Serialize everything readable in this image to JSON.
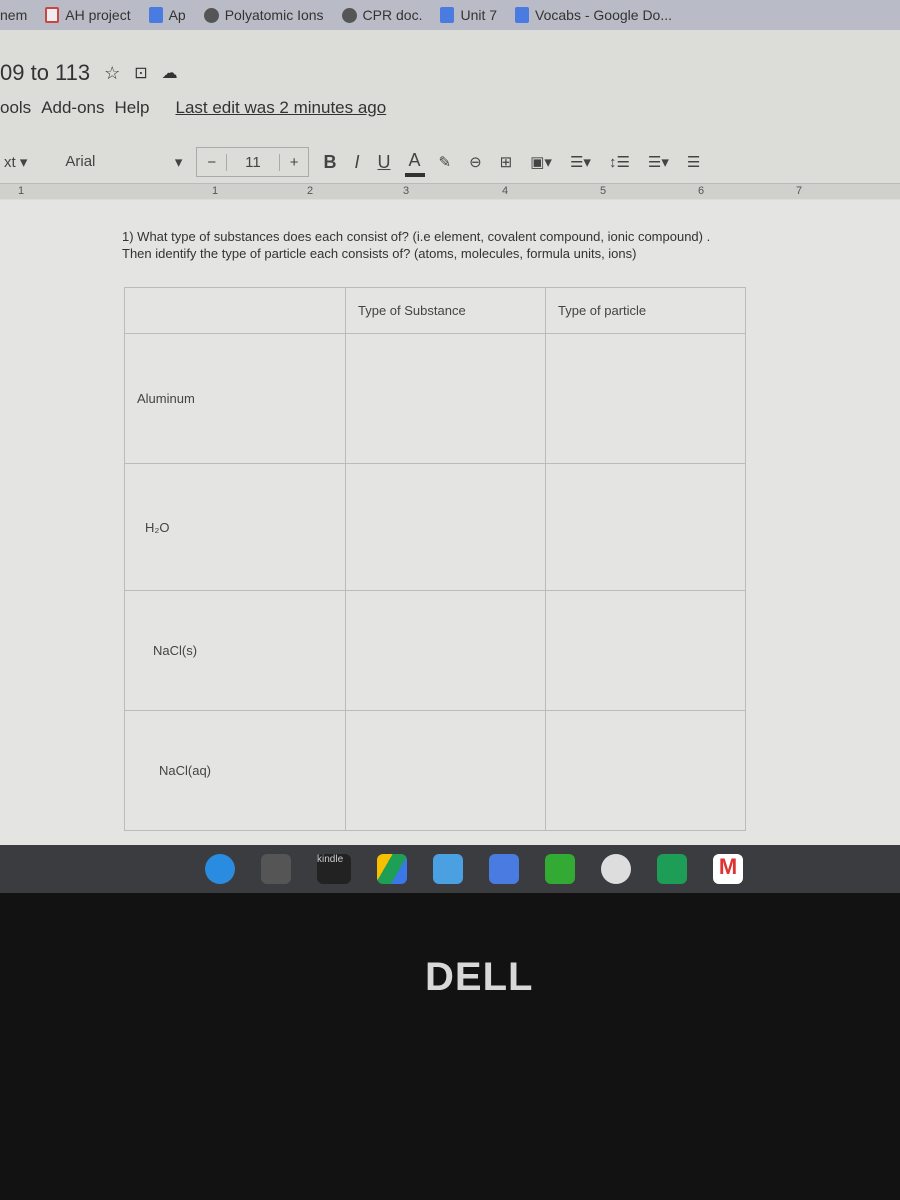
{
  "bookmarks": [
    "nem",
    "AH project",
    "Ap",
    "Polyatomic Ions",
    "CPR doc.",
    "Unit 7",
    "Vocabs - Google Do..."
  ],
  "doc": {
    "title": "09 to 113",
    "menu": [
      "ools",
      "Add-ons",
      "Help"
    ],
    "last_edit": "Last edit was 2 minutes ago"
  },
  "toolbar": {
    "style": "xt",
    "font": "Arial",
    "size_minus": "−",
    "font_size": "11",
    "size_plus": "+",
    "bold": "B",
    "italic": "I",
    "underline": "U",
    "text_color": "A"
  },
  "ruler": [
    "1",
    "1",
    "2",
    "3",
    "4",
    "5",
    "6",
    "7"
  ],
  "question": "1) What type of substances does each consist of? (i.e  element, covalent compound, ionic compound) . Then identify the type of particle each consists of? (atoms, molecules, formula units, ions)",
  "table": {
    "headers": [
      "",
      "Type of Substance",
      "Type of particle"
    ],
    "rows": [
      [
        "Aluminum",
        "",
        ""
      ],
      [
        "H₂O",
        "",
        ""
      ],
      [
        "NaCl(s)",
        "",
        ""
      ],
      [
        "NaCl(aq)",
        "",
        ""
      ]
    ]
  },
  "taskbar": {
    "kindle": "kindle"
  },
  "bezel": {
    "logo": "DELL"
  }
}
